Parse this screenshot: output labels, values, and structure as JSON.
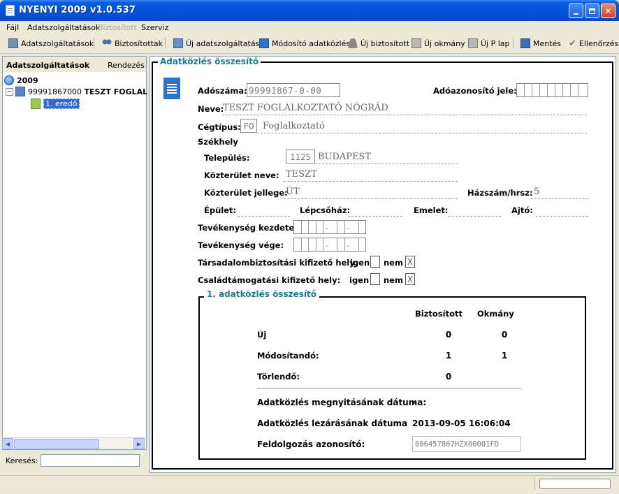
{
  "window": {
    "title": "NYENYI 2009   v1.0.537"
  },
  "menu": {
    "items": [
      "Fájl",
      "Adatszolgáltatások",
      "Biztosított",
      "Szerviz"
    ]
  },
  "toolbar": {
    "items": [
      "Adatszolgáltatások",
      "Biztosítottak",
      "Új adatszolgáltatás",
      "Módosító adatközlés",
      "Új biztosított",
      "Új okmány",
      "Új P lap",
      "Mentés",
      "Ellenőrzés"
    ]
  },
  "left": {
    "header": "Adatszolgáltatások",
    "sort_label": "Rendezés",
    "tree": {
      "year": "2009",
      "company_id": "99991867000",
      "company_name": "TESZT FOGLALKO",
      "child": "1. eredő"
    },
    "search_label": "Keresés:",
    "search_value": ""
  },
  "form": {
    "group_title": "Adatközlés összesítő",
    "tax_no_label": "Adószáma:",
    "tax_no_value": "99991867-0-00",
    "tax_id_label": "Adóazonosító jele:",
    "name_label": "Neve:",
    "name_value": "TESZT FOGLALKOZTATÓ NÓGRÁD",
    "type_label": "Cégtípus:",
    "type_code": "FO",
    "type_value": "Foglalkoztató",
    "seat_label": "Székhely",
    "city_label": "Település:",
    "zip": "1125",
    "city": "BUDAPEST",
    "street_label": "Közterület neve:",
    "street_value": "TESZT",
    "street_type_label": "Közterület jellege:",
    "street_type_value": "ÚT",
    "house_label": "Házszám/hrsz:",
    "house_value": "5",
    "building_label": "Épület:",
    "staircase_label": "Lépcsőház:",
    "floor_label": "Emelet:",
    "door_label": "Ajtó:",
    "start_label": "Tevékenység kezdete:",
    "end_label": "Tevékenység vége:",
    "date_sep": ".",
    "social_label": "Társadalombiztosítási kifizető hely:",
    "family_label": "Családtámogatási kifizető hely:",
    "yes": "igen",
    "no": "nem",
    "social_no_mark": "X",
    "family_no_mark": "X"
  },
  "summary": {
    "title": "1. adatközlés összesítő",
    "col1": "Biztosított",
    "col2": "Okmány",
    "row_new": "Új",
    "new_1": "0",
    "new_2": "0",
    "row_mod": "Módosítandó:",
    "mod_1": "1",
    "mod_2": "1",
    "row_del": "Törlendő:",
    "del_1": "0",
    "open_label": "Adatközlés megnyitásának dátuma:",
    "open_value": "-",
    "close_label": "Adatközlés lezárásának dátuma",
    "close_value": "2013-09-05 16:06:04",
    "proc_label": "Feldolgozás azonosító:",
    "proc_value": "006457867HZX00001FD"
  },
  "colors": {
    "accent": "#217a8f",
    "titlebar": "#0553d6"
  }
}
